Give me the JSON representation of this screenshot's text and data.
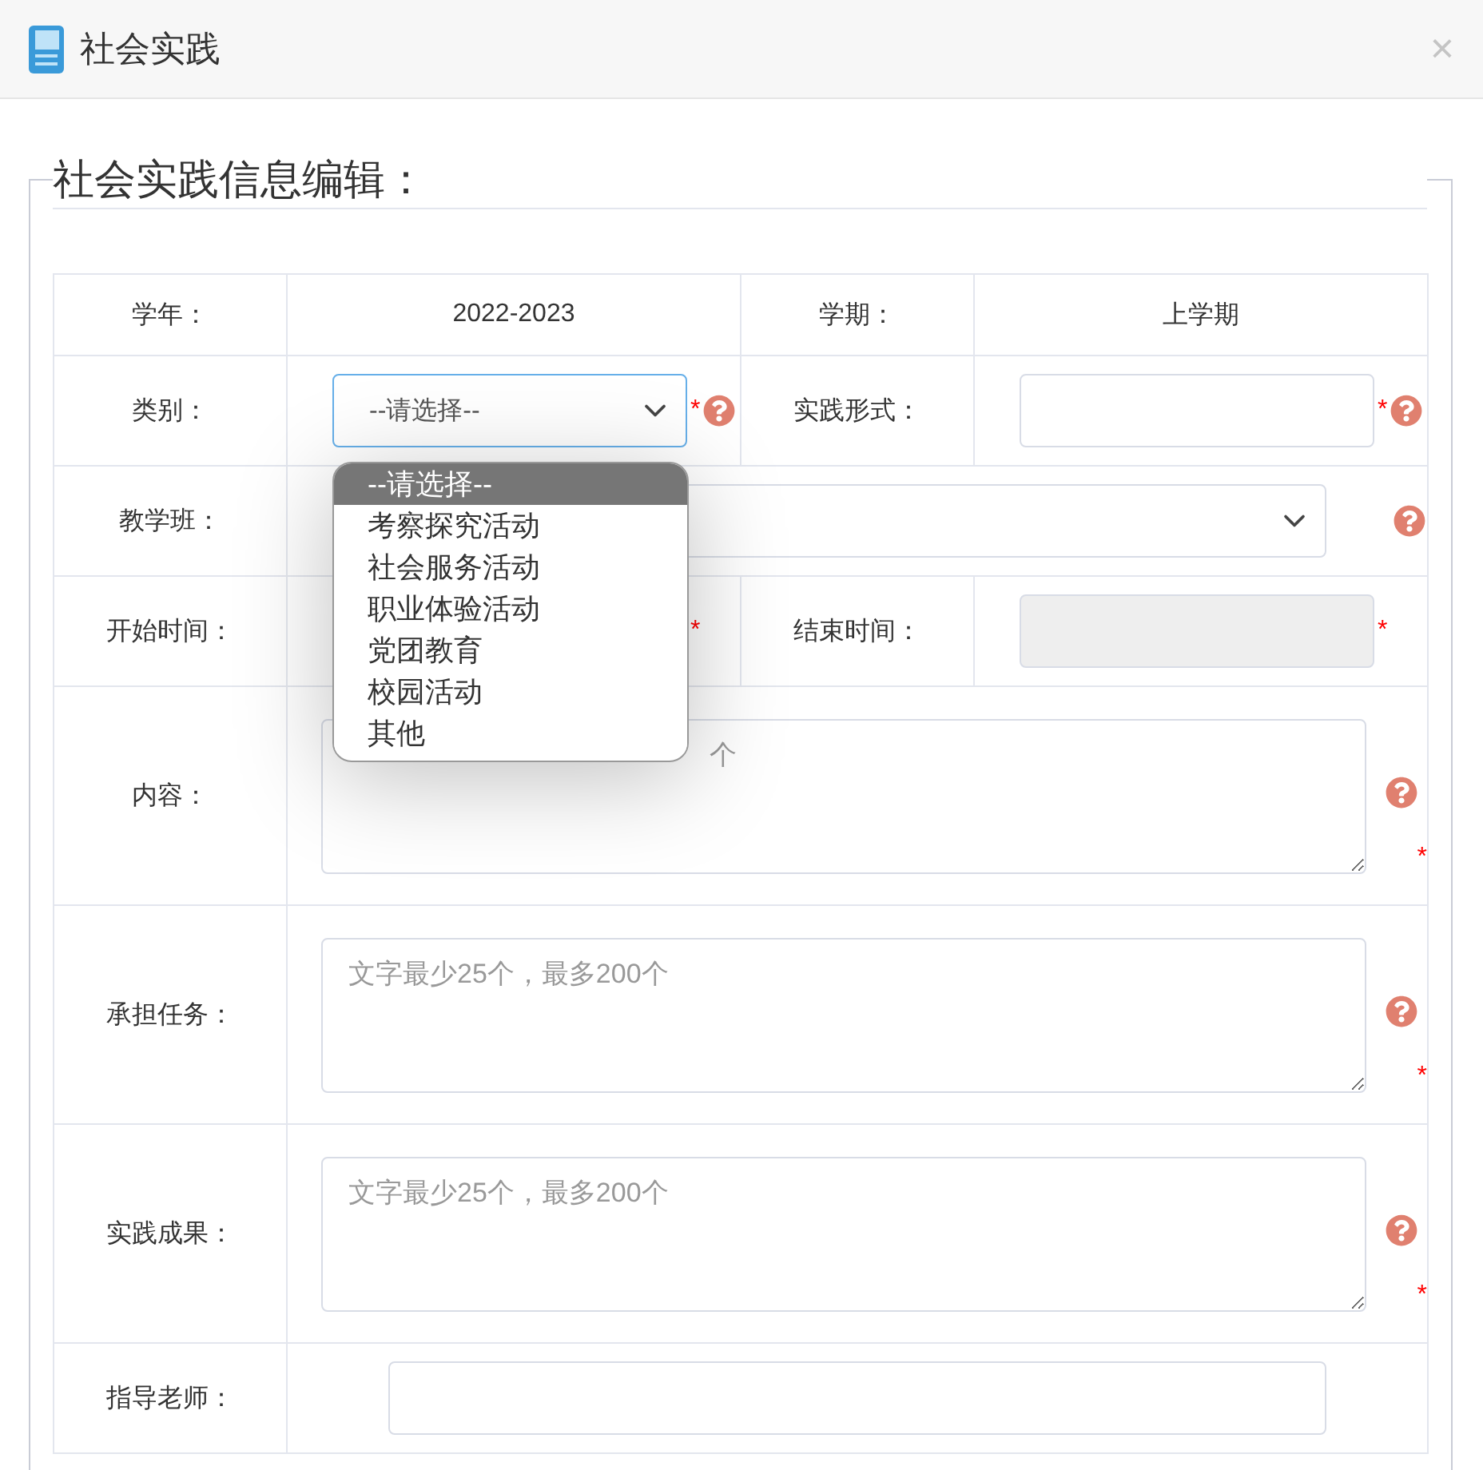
{
  "dialog": {
    "title": "社会实践",
    "close": "×"
  },
  "form": {
    "legend": "社会实践信息编辑：",
    "school_year": {
      "label": "学年：",
      "value": "2022-2023"
    },
    "term": {
      "label": "学期：",
      "value": "上学期"
    },
    "category": {
      "label": "类别：",
      "value": "--请选择--",
      "required_mark": "*",
      "help": true,
      "expanded": true,
      "options": [
        {
          "label": "--请选择--",
          "selected": true
        },
        {
          "label": "考察探究活动",
          "selected": false
        },
        {
          "label": "社会服务活动",
          "selected": false
        },
        {
          "label": "职业体验活动",
          "selected": false
        },
        {
          "label": "党团教育",
          "selected": false
        },
        {
          "label": "校园活动",
          "selected": false
        },
        {
          "label": "其他",
          "selected": false
        }
      ]
    },
    "practice_form": {
      "label": "实践形式：",
      "required_mark": "*",
      "help": true
    },
    "teaching_class": {
      "label": "教学班：",
      "help": true
    },
    "start_time": {
      "label": "开始时间：",
      "required_mark": "*"
    },
    "end_time": {
      "label": "结束时间：",
      "required_mark": "*",
      "disabled": true
    },
    "textareas": [
      {
        "label": "内容：",
        "placeholder": "个",
        "required_mark": "*",
        "help": true
      },
      {
        "label": "承担任务：",
        "placeholder": "文字最少25个，最多200个",
        "required_mark": "*",
        "help": true
      },
      {
        "label": "实践成果：",
        "placeholder": "文字最少25个，最多200个",
        "required_mark": "*",
        "help": true
      }
    ],
    "teacher": {
      "label": "指导老师："
    }
  }
}
